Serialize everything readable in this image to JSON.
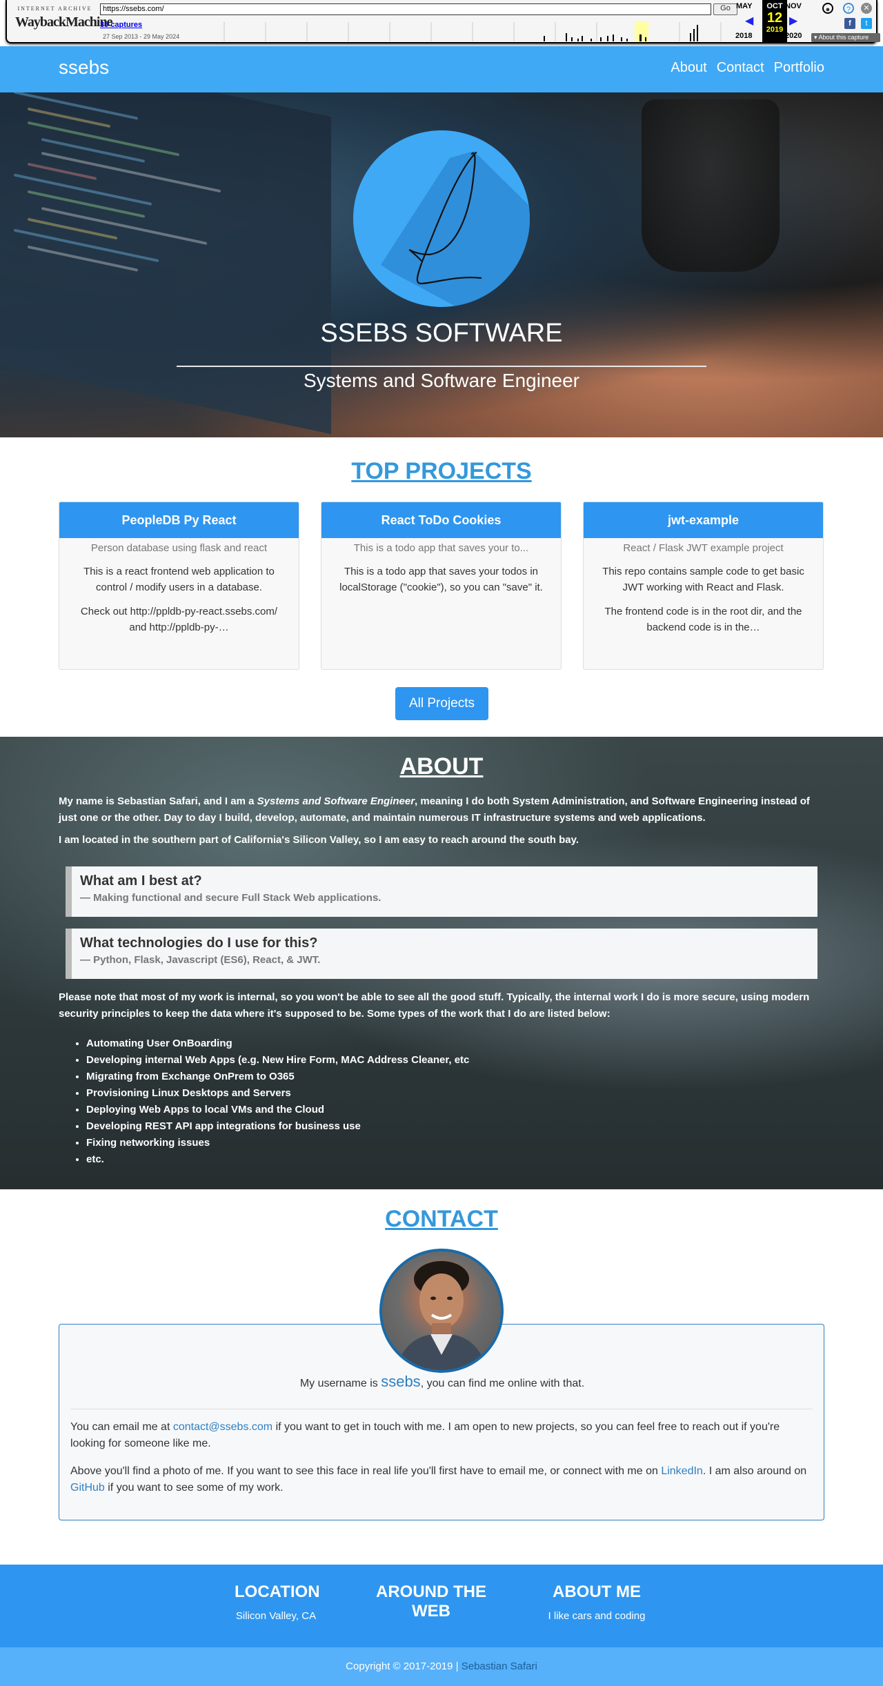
{
  "wayback": {
    "logo_top": "INTERNET ARCHIVE",
    "logo_main": "WaybackMachine",
    "url": "https://ssebs.com/",
    "go_label": "Go",
    "captures_link": "35 captures",
    "date_range": "27 Sep 2013 - 29 May 2024",
    "prev_month": "MAY",
    "cur_month": "OCT",
    "next_month": "NOV",
    "cur_day": "12",
    "prev_year": "2018",
    "cur_year": "2019",
    "next_year": "2020",
    "about_capture": "About this capture"
  },
  "nav": {
    "brand": "ssebs",
    "links": [
      "About",
      "Contact",
      "Portfolio"
    ]
  },
  "hero": {
    "title": "SSEBS SOFTWARE",
    "subtitle": "Systems and Software Engineer"
  },
  "projects": {
    "title": "TOP PROJECTS",
    "cards": [
      {
        "name": "PeopleDB Py React",
        "desc": "Person database using flask and react",
        "p1": "This is a react frontend web application to control / modify users in a database.",
        "p2": "Check out http://ppldb-py-react.ssebs.com/ and http://ppldb-py-…"
      },
      {
        "name": "React ToDo Cookies",
        "desc": "This is a todo app that saves your to...",
        "p1": "This is a todo app that saves your todos in localStorage (\"cookie\"), so you can \"save\" it.",
        "p2": ""
      },
      {
        "name": "jwt-example",
        "desc": "React / Flask JWT example project",
        "p1": "This repo contains sample code to get basic JWT working with React and Flask.",
        "p2": "The frontend code is in the root dir, and the backend code is in the…"
      }
    ],
    "all_button": "All Projects"
  },
  "about": {
    "title": "ABOUT",
    "intro_a": "My name is Sebastian Safari, and I am a ",
    "intro_em": "Systems and Software Engineer",
    "intro_b": ", meaning I do both System Administration, and Software Engineering instead of just one or the other. Day to day I build, develop, automate, and maintain numerous IT infrastructure systems and web applications.",
    "location": "I am located in the southern part of California's Silicon Valley, so I am easy to reach around the south bay.",
    "q1": "What am I best at?",
    "a1": "— Making functional and secure Full Stack Web applications.",
    "q2": "What technologies do I use for this?",
    "a2": "— Python, Flask, Javascript (ES6), React, & JWT.",
    "note": "Please note that most of my work is internal, so you won't be able to see all the good stuff. Typically, the internal work I do is more secure, using modern security principles to keep the data where it's supposed to be. Some types of the work that I do are listed below:",
    "items": [
      "Automating User OnBoarding",
      "Developing internal Web Apps (e.g. New Hire Form, MAC Address Cleaner, etc",
      "Migrating from Exchange OnPrem to O365",
      "Provisioning Linux Desktops and Servers",
      "Deploying Web Apps to local VMs and the Cloud",
      "Developing REST API app integrations for business use",
      "Fixing networking issues",
      "etc."
    ]
  },
  "contact": {
    "title": "CONTACT",
    "uname_a": "My username is ",
    "uname": "ssebs",
    "uname_b": ", you can find me online with that.",
    "p1_a": "You can email me at ",
    "email": "contact@ssebs.com",
    "p1_b": " if you want to get in touch with me. I am open to new projects, so you can feel free to reach out if you're looking for someone like me.",
    "p2_a": "Above you'll find a photo of me. If you want to see this face in real life you'll first have to email me, or connect with me on ",
    "linkedin": "LinkedIn",
    "p2_b": ". I am also around on ",
    "github": "GitHub",
    "p2_c": " if you want to see some of my work."
  },
  "footer": {
    "location_h": "LOCATION",
    "location_v": "Silicon Valley, CA",
    "web_h": "AROUND THE WEB",
    "aboutme_h": "ABOUT ME",
    "aboutme_v": "I like cars and coding",
    "copyright": "Copyright © 2017-2019 | ",
    "author": "Sebastian Safari"
  },
  "colors": {
    "primary": "#3fa9f5",
    "card_header": "#2e96f0",
    "link": "#2e7fc0"
  }
}
